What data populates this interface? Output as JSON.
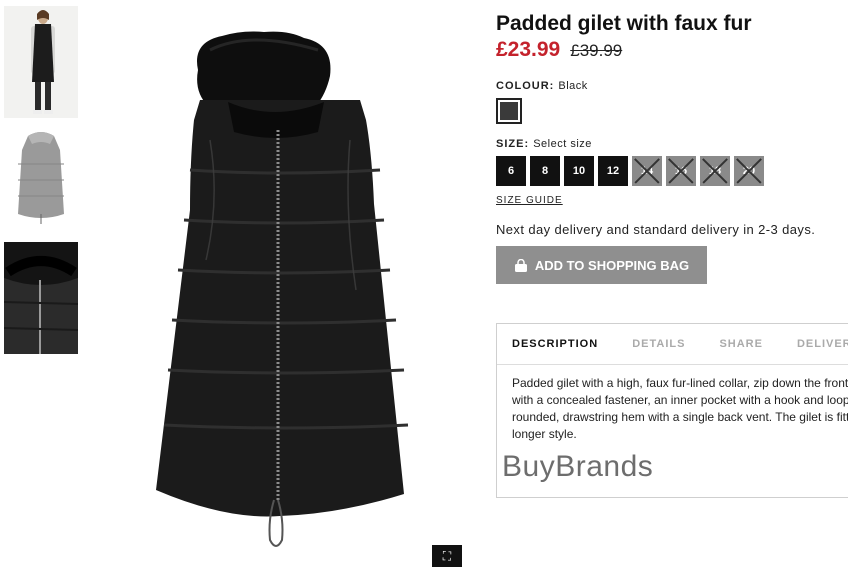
{
  "product": {
    "title": "Padded gilet with faux fur",
    "price_now": "£23.99",
    "price_old": "£39.99"
  },
  "colour": {
    "label": "COLOUR:",
    "value": "Black",
    "swatch_color": "#3a3a3a"
  },
  "size": {
    "label": "SIZE:",
    "value": "Select size",
    "options": [
      {
        "label": "6",
        "available": true
      },
      {
        "label": "8",
        "available": true
      },
      {
        "label": "10",
        "available": true
      },
      {
        "label": "12",
        "available": true
      },
      {
        "label": "14",
        "available": false
      },
      {
        "label": "16",
        "available": false
      },
      {
        "label": "18",
        "available": false
      },
      {
        "label": "20",
        "available": false
      }
    ],
    "guide_label": "SIZE GUIDE"
  },
  "delivery_text": "Next day delivery and standard delivery in 2-3 days.",
  "add_button": {
    "label": "ADD TO SHOPPING BAG",
    "icon": "shopping-bag-icon"
  },
  "tabs": [
    {
      "label": "DESCRIPTION",
      "active": true
    },
    {
      "label": "DETAILS",
      "active": false
    },
    {
      "label": "SHARE",
      "active": false
    },
    {
      "label": "DELIVERY",
      "active": false
    }
  ],
  "description_lines": [
    "Padded gilet with a high, faux fur-lined collar, zip down the front",
    "with a concealed fastener, an inner pocket with a hook and loop",
    "rounded, drawstring hem with a single back vent. The gilet is fitt",
    "longer style."
  ],
  "watermark": "BuyBrands",
  "zoom_icon": "expand-icon",
  "colors": {
    "sale_red": "#c4222c",
    "button_grey": "#8f8f8f"
  }
}
